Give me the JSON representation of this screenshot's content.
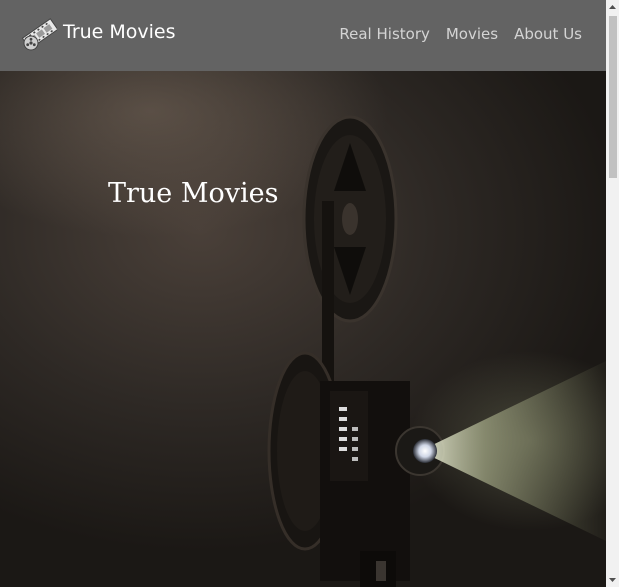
{
  "navbar": {
    "brand_name": "True Movies",
    "brand_logo_icon": "film-reel-icon",
    "links": [
      {
        "label": "Real History"
      },
      {
        "label": "Movies"
      },
      {
        "label": "About Us"
      }
    ]
  },
  "hero": {
    "title": "True Movies",
    "background_image": "film-projector-photo"
  },
  "colors": {
    "navbar_bg": "#636363",
    "nav_link": "#d4d4d4",
    "brand_text": "#ffffff",
    "hero_title": "#ffffff"
  }
}
